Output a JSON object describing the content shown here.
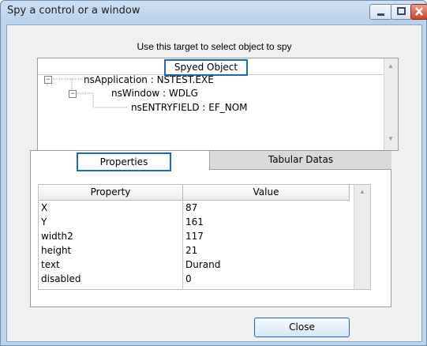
{
  "window": {
    "title": "Spy a control or a window"
  },
  "hint_text": "Use this target to select object to spy",
  "tree": {
    "header": "Spyed Object",
    "nodes": [
      {
        "label": "nsApplication : NSTEST.EXE"
      },
      {
        "label": "nsWindow : WDLG"
      },
      {
        "label": "nsENTRYFIELD : EF_NOM"
      }
    ]
  },
  "tabs": {
    "properties": "Properties",
    "tabular": "Tabular Datas"
  },
  "grid": {
    "columns": [
      "Property",
      "Value"
    ],
    "rows": [
      {
        "property": "X",
        "value": "87"
      },
      {
        "property": "Y",
        "value": "161"
      },
      {
        "property": "width2",
        "value": "117"
      },
      {
        "property": "height",
        "value": "21"
      },
      {
        "property": "text",
        "value": "Durand"
      },
      {
        "property": "disabled",
        "value": "0"
      }
    ]
  },
  "buttons": {
    "close": "Close"
  }
}
